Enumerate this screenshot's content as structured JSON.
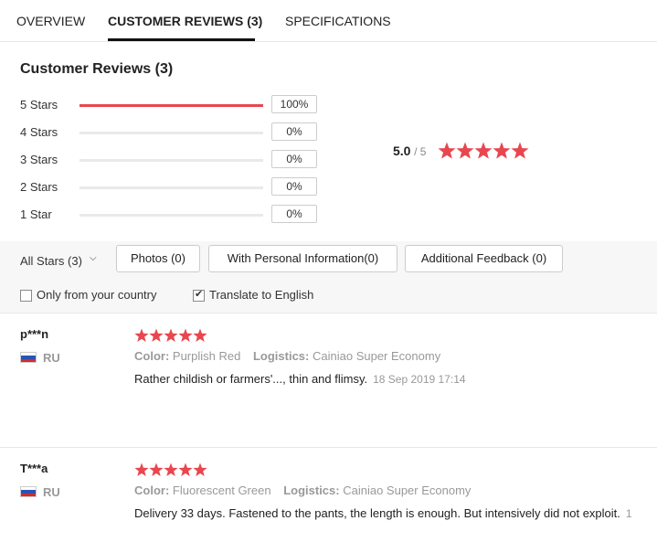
{
  "tabs": [
    {
      "label": "OVERVIEW"
    },
    {
      "label": "CUSTOMER REVIEWS (3)"
    },
    {
      "label": "SPECIFICATIONS"
    }
  ],
  "section_title": "Customer Reviews (3)",
  "ratings": [
    {
      "label": "5 Stars",
      "percent": "100%",
      "fill": 1.0
    },
    {
      "label": "4 Stars",
      "percent": "0%",
      "fill": 0
    },
    {
      "label": "3 Stars",
      "percent": "0%",
      "fill": 0
    },
    {
      "label": "2 Stars",
      "percent": "0%",
      "fill": 0
    },
    {
      "label": "1 Star",
      "percent": "0%",
      "fill": 0
    }
  ],
  "average": {
    "score": "5.0",
    "out_of": "/ 5",
    "stars": 5
  },
  "filters": {
    "all_stars": "All Stars (3)",
    "photos": "Photos (0)",
    "personal": "With Personal Information(0)",
    "additional": "Additional Feedback (0)",
    "only_country": "Only from your country",
    "translate": "Translate to English",
    "only_country_checked": false,
    "translate_checked": true
  },
  "reviews": [
    {
      "name": "p***n",
      "country": "RU",
      "stars": 5,
      "color_label": "Color:",
      "color": "Purplish Red",
      "logistics_label": "Logistics:",
      "logistics": "Cainiao Super Economy",
      "text": "Rather childish or farmers'..., thin and flimsy.",
      "date": "18 Sep 2019 17:14"
    },
    {
      "name": "T***a",
      "country": "RU",
      "stars": 5,
      "color_label": "Color:",
      "color": "Fluorescent Green",
      "logistics_label": "Logistics:",
      "logistics": "Cainiao Super Economy",
      "text": "Delivery 33 days. Fastened to the pants, the length is enough. But intensively did not exploit.",
      "date": "1"
    }
  ],
  "colors": {
    "accent": "#e8474f",
    "muted": "#999999"
  }
}
